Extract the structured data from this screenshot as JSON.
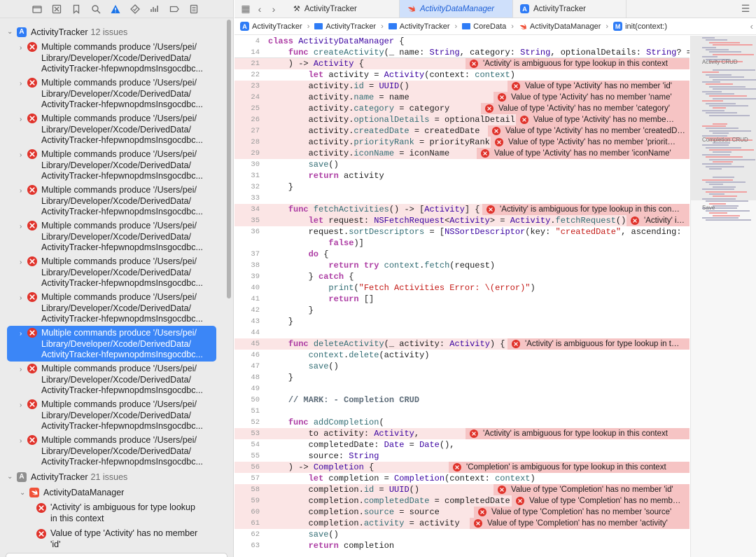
{
  "navigator": {
    "toolbar_icons": [
      "folder-icon",
      "source-control-icon",
      "bookmark-icon",
      "find-icon",
      "issue-icon",
      "test-icon",
      "debug-icon",
      "breakpoint-icon",
      "report-icon"
    ],
    "project1": {
      "name": "ActivityTracker",
      "count": "12 issues"
    },
    "issues": [
      {
        "l1": "Multiple commands produce '/Users/pei/",
        "l2": "Library/Developer/Xcode/DerivedData/",
        "l3": "ActivityTracker-hfepwnopdmsInsgocdbc..."
      },
      {
        "l1": "Multiple commands produce '/Users/pei/",
        "l2": "Library/Developer/Xcode/DerivedData/",
        "l3": "ActivityTracker-hfepwnopdmsInsgocdbc..."
      },
      {
        "l1": "Multiple commands produce '/Users/pei/",
        "l2": "Library/Developer/Xcode/DerivedData/",
        "l3": "ActivityTracker-hfepwnopdmsInsgocdbc..."
      },
      {
        "l1": "Multiple commands produce '/Users/pei/",
        "l2": "Library/Developer/Xcode/DerivedData/",
        "l3": "ActivityTracker-hfepwnopdmsInsgocdbc..."
      },
      {
        "l1": "Multiple commands produce '/Users/pei/",
        "l2": "Library/Developer/Xcode/DerivedData/",
        "l3": "ActivityTracker-hfepwnopdmsInsgocdbc..."
      },
      {
        "l1": "Multiple commands produce '/Users/pei/",
        "l2": "Library/Developer/Xcode/DerivedData/",
        "l3": "ActivityTracker-hfepwnopdmsInsgocdbc..."
      },
      {
        "l1": "Multiple commands produce '/Users/pei/",
        "l2": "Library/Developer/Xcode/DerivedData/",
        "l3": "ActivityTracker-hfepwnopdmsInsgocdbc..."
      },
      {
        "l1": "Multiple commands produce '/Users/pei/",
        "l2": "Library/Developer/Xcode/DerivedData/",
        "l3": "ActivityTracker-hfepwnopdmsInsgocdbc..."
      },
      {
        "l1": "Multiple commands produce '/Users/pei/",
        "l2": "Library/Developer/Xcode/DerivedData/",
        "l3": "ActivityTracker-hfepwnopdmsInsgocdbc..."
      },
      {
        "l1": "Multiple commands produce '/Users/pei/",
        "l2": "Library/Developer/Xcode/DerivedData/",
        "l3": "ActivityTracker-hfepwnopdmsInsgocdbc..."
      },
      {
        "l1": "Multiple commands produce '/Users/pei/",
        "l2": "Library/Developer/Xcode/DerivedData/",
        "l3": "ActivityTracker-hfepwnopdmsInsgocdbc..."
      },
      {
        "l1": "Multiple commands produce '/Users/pei/",
        "l2": "Library/Developer/Xcode/DerivedData/",
        "l3": "ActivityTracker-hfepwnopdmsInsgocdbc..."
      }
    ],
    "selected_issue_index": 8,
    "project2": {
      "name": "ActivityTracker",
      "count": "21 issues"
    },
    "file": {
      "name": "ActivityDataManager"
    },
    "file_issues": [
      {
        "l1": "'Activity' is ambiguous for type lookup",
        "l2": "in this context"
      },
      {
        "l1": "Value of type 'Activity' has no member",
        "l2": "'id'"
      }
    ]
  },
  "tabs": [
    {
      "label": "ActivityTracker",
      "icon": "hammer-icon",
      "active": false
    },
    {
      "label": "ActivityDataManager",
      "icon": "swift-icon",
      "active": true
    },
    {
      "label": "ActivityTracker",
      "icon": "app-icon",
      "active": false
    }
  ],
  "breadcrumbs": [
    "ActivityTracker",
    "ActivityTracker",
    "ActivityTracker",
    "CoreData",
    "ActivityDataManager",
    "init(context:)"
  ],
  "code_lines": [
    {
      "n": "4",
      "t": "<span class=\"kw\">class</span> <span class=\"ty\">ActivityDataManager</span> {",
      "sticky": true
    },
    {
      "n": "14",
      "t": "    <span class=\"kw\">func</span> <span class=\"fn\">createActivity</span>(_ name: <span class=\"ty\">String</span>, category: <span class=\"ty\">String</span>, optionalDetails: <span class=\"ty\">String</span>? =…",
      "sticky": true
    },
    {
      "n": "21",
      "t": "    ) -> <span class=\"ty\">Activity</span> {",
      "err": "'Activity' is ambiguous for type lookup in this context",
      "ew": 320
    },
    {
      "n": "22",
      "t": "        <span class=\"kw\">let</span> activity = <span class=\"ty\">Activity</span>(context: <span class=\"fn\">context</span>)"
    },
    {
      "n": "23",
      "t": "        activity.<span class=\"fn\">id</span> = <span class=\"ty\">UUID</span>()",
      "err": "Value of type 'Activity' has no member 'id'",
      "ew": 260
    },
    {
      "n": "24",
      "t": "        activity.<span class=\"fn\">name</span> = name",
      "err": "Value of type 'Activity' has no member 'name'",
      "ew": 280
    },
    {
      "n": "25",
      "t": "        activity.<span class=\"fn\">category</span> = category",
      "err": "Value of type 'Activity' has no member 'category'",
      "ew": 298
    },
    {
      "n": "26",
      "t": "        activity.<span class=\"fn\">optionalDetails</span> = optionalDetails",
      "err": "Value of type 'Activity' has no membe…",
      "ew": 248
    },
    {
      "n": "27",
      "t": "        activity.<span class=\"fn\">createdDate</span> = createdDate",
      "err": "Value of type 'Activity' has no member 'createdD…",
      "ew": 288
    },
    {
      "n": "28",
      "t": "        activity.<span class=\"fn\">priorityRank</span> = priorityRank",
      "err": "Value of type 'Activity' has no member 'priorit…",
      "ew": 284
    },
    {
      "n": "29",
      "t": "        activity.<span class=\"fn\">iconName</span> = iconName",
      "err": "Value of type 'Activity' has no member 'iconName'",
      "ew": 304
    },
    {
      "n": "30",
      "t": "        <span class=\"fn\">save</span>()"
    },
    {
      "n": "31",
      "t": "        <span class=\"kw\">return</span> activity"
    },
    {
      "n": "32",
      "t": "    }"
    },
    {
      "n": "33",
      "t": ""
    },
    {
      "n": "34",
      "t": "    <span class=\"kw\">func</span> <span class=\"fn\">fetchActivities</span>() -> [<span class=\"ty\">Activity</span>] {",
      "err": "'Activity' is ambiguous for type lookup in this con…",
      "ew": 296
    },
    {
      "n": "35",
      "t": "        <span class=\"kw\">let</span> request: <span class=\"ty\">NSFetchRequest</span>&lt;<span class=\"ty\">Activity</span>&gt; = <span class=\"ty\">Activity</span>.<span class=\"fn\">fetchRequest</span>()",
      "err": "'Activity' i…",
      "ew": 90
    },
    {
      "n": "36",
      "t": "        request.<span class=\"fn\">sortDescriptors</span> = [<span class=\"ty\">NSSortDescriptor</span>(key: <span class=\"st\">\"createdDate\"</span>, ascending:"
    },
    {
      "n": "",
      "t": "            <span class=\"kw\">false</span>)]"
    },
    {
      "n": "37",
      "t": "        <span class=\"kw\">do</span> {"
    },
    {
      "n": "38",
      "t": "            <span class=\"kw\">return</span> <span class=\"kw\">try</span> <span class=\"fn\">context</span>.<span class=\"fn\">fetch</span>(request)"
    },
    {
      "n": "39",
      "t": "        } <span class=\"kw\">catch</span> {"
    },
    {
      "n": "40",
      "t": "            <span class=\"fn\">print</span>(<span class=\"st\">\"Fetch Activities Error: \\(error)\"</span>)"
    },
    {
      "n": "41",
      "t": "            <span class=\"kw\">return</span> []"
    },
    {
      "n": "42",
      "t": "        }"
    },
    {
      "n": "43",
      "t": "    }"
    },
    {
      "n": "44",
      "t": ""
    },
    {
      "n": "45",
      "t": "    <span class=\"kw\">func</span> <span class=\"fn\">deleteActivity</span>(_ activity: <span class=\"ty\">Activity</span>) {",
      "err": "'Activity' is ambiguous for type lookup in t…",
      "ew": 260
    },
    {
      "n": "46",
      "t": "        <span class=\"fn\">context</span>.<span class=\"fn\">delete</span>(activity)"
    },
    {
      "n": "47",
      "t": "        <span class=\"fn\">save</span>()"
    },
    {
      "n": "48",
      "t": "    }"
    },
    {
      "n": "49",
      "t": ""
    },
    {
      "n": "50",
      "t": "    <span class=\"cm\">// MARK: - Completion CRUD</span>"
    },
    {
      "n": "51",
      "t": ""
    },
    {
      "n": "52",
      "t": "    <span class=\"kw\">func</span> <span class=\"fn\">addCompletion</span>("
    },
    {
      "n": "53",
      "t": "        to activity: <span class=\"ty\">Activity</span>,",
      "err": "'Activity' is ambiguous for type lookup in this context",
      "ew": 320
    },
    {
      "n": "54",
      "t": "        completedDate: <span class=\"ty\">Date</span> = <span class=\"ty\">Date</span>(),"
    },
    {
      "n": "55",
      "t": "        source: <span class=\"ty\">String</span>"
    },
    {
      "n": "56",
      "t": "    ) -> <span class=\"ty\">Completion</span> {",
      "err": "'Completion' is ambiguous for type lookup in this context",
      "ew": 344
    },
    {
      "n": "57",
      "t": "        <span class=\"kw\">let</span> completion = <span class=\"ty\">Completion</span>(context: <span class=\"fn\">context</span>)"
    },
    {
      "n": "58",
      "t": "        completion.<span class=\"fn\">id</span> = <span class=\"ty\">UUID</span>()",
      "err": "Value of type 'Completion' has no member 'id'",
      "ew": 280
    },
    {
      "n": "59",
      "t": "        completion.<span class=\"fn\">completedDate</span> = completedDate",
      "err": "Value of type 'Completion' has no memb…",
      "ew": 254
    },
    {
      "n": "60",
      "t": "        completion.<span class=\"fn\">source</span> = source",
      "err": "Value of type 'Completion' has no member 'source'",
      "ew": 308
    },
    {
      "n": "61",
      "t": "        completion.<span class=\"fn\">activity</span> = activity",
      "err": "Value of type 'Completion' has no member 'activity'",
      "ew": 314
    },
    {
      "n": "62",
      "t": "        <span class=\"fn\">save</span>()"
    },
    {
      "n": "63",
      "t": "        <span class=\"kw\">return</span> completion"
    }
  ],
  "minimap": {
    "labels": [
      "Activity CRUD",
      "Completion CRUD",
      "Save"
    ]
  },
  "colors": {
    "error": "#e0332b",
    "selection": "#3b86f7",
    "error_line": "#fbe5e5",
    "error_bubble": "#f6c4c4"
  }
}
